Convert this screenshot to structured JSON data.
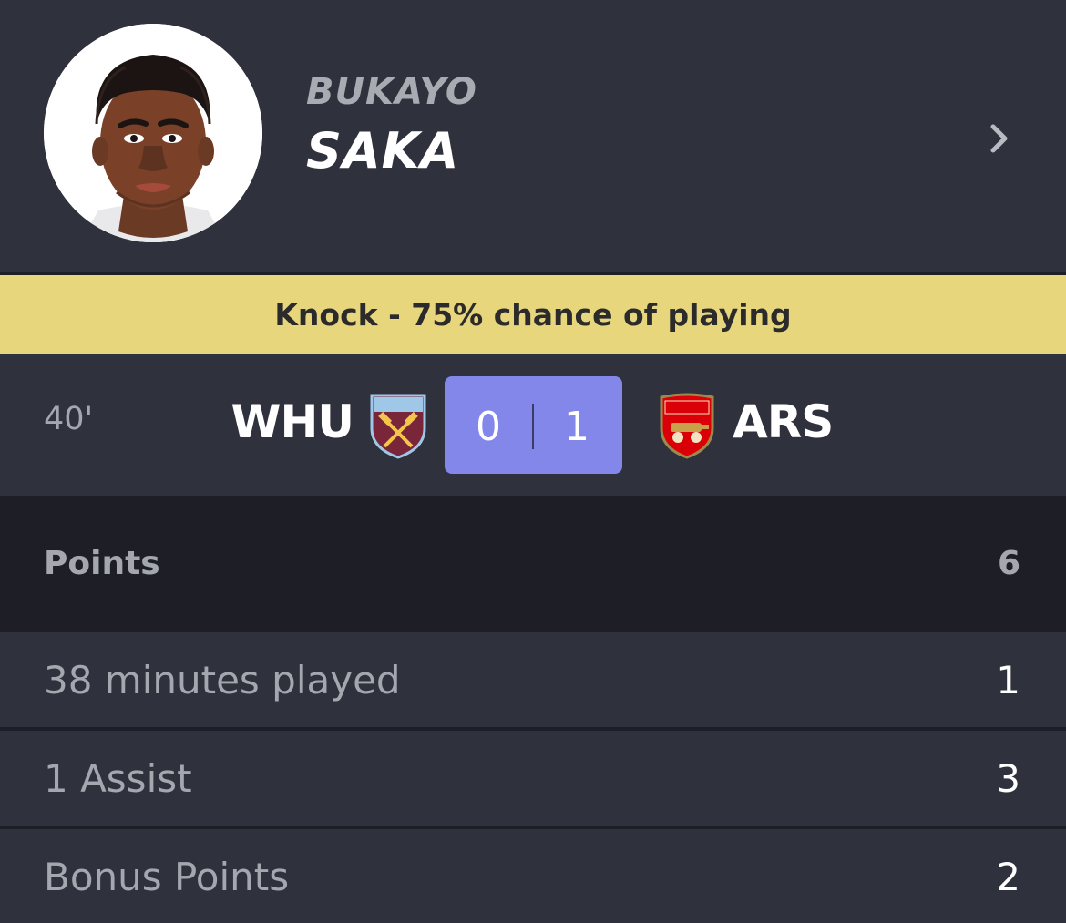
{
  "player": {
    "first_name": "BUKAYO",
    "last_name": "SAKA",
    "avatar_icon": "player-portrait",
    "chevron_icon": "chevron-right-icon"
  },
  "status": {
    "text": "Knock - 75% chance of playing",
    "color": "#e8d67c"
  },
  "match": {
    "minute": "40'",
    "home": {
      "code": "WHU",
      "badge_icon": "west-ham-crest",
      "score": "0"
    },
    "away": {
      "code": "ARS",
      "badge_icon": "arsenal-crest",
      "score": "1"
    },
    "score_color": "#8487ea"
  },
  "points": {
    "label": "Points",
    "total": "6",
    "rows": [
      {
        "label": "38 minutes played",
        "value": "1"
      },
      {
        "label": "1 Assist",
        "value": "3"
      },
      {
        "label": "Bonus Points",
        "value": "2"
      }
    ]
  }
}
